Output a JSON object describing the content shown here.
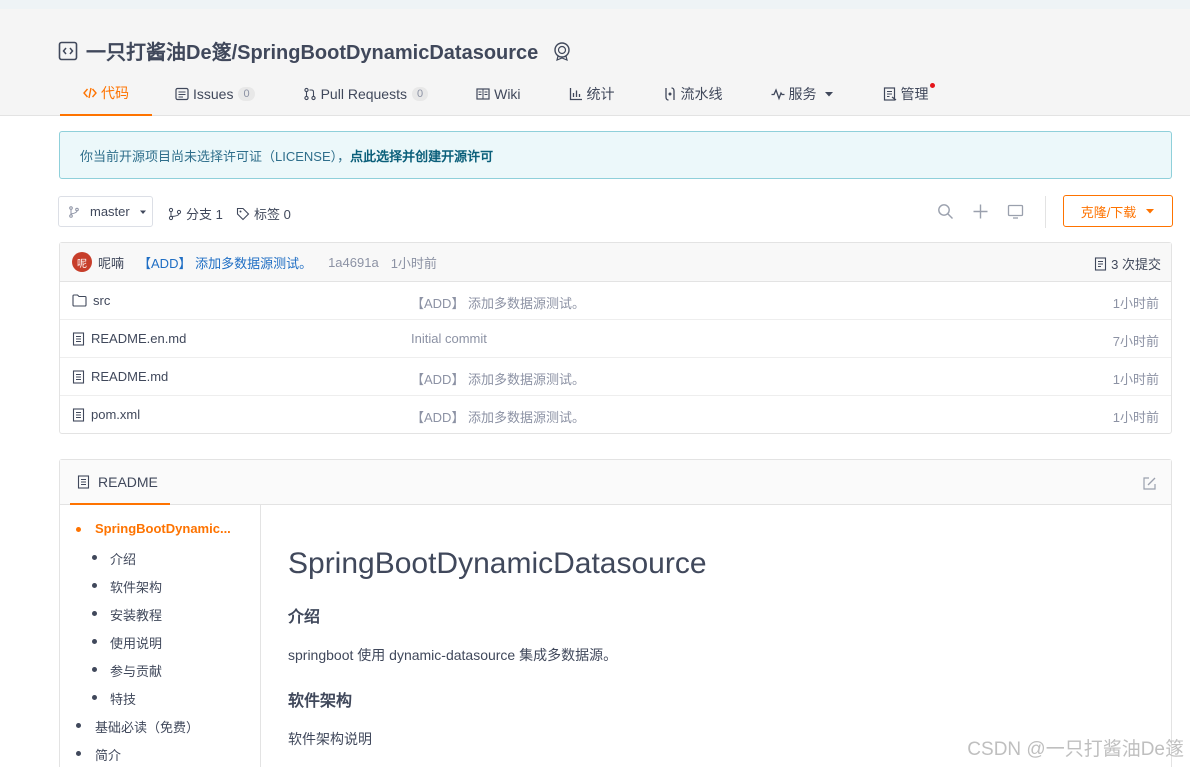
{
  "repo": {
    "title": "一只打酱油De篴/SpringBootDynamicDatasource"
  },
  "tabs": [
    {
      "label": "代码",
      "active": true
    },
    {
      "label": "Issues",
      "count": "0"
    },
    {
      "label": "Pull Requests",
      "count": "0"
    },
    {
      "label": "Wiki"
    },
    {
      "label": "统计"
    },
    {
      "label": "流水线"
    },
    {
      "label": "服务"
    },
    {
      "label": "管理"
    }
  ],
  "notice": {
    "text": "你当前开源项目尚未选择许可证（LICENSE），",
    "link": "点此选择并创建开源许可"
  },
  "branchbar": {
    "branch": "master",
    "branches": "分支 1",
    "tags": "标签 0",
    "clone": "克隆/下载"
  },
  "commit": {
    "avatar": "呢",
    "author": "呢喃",
    "message": "【ADD】 添加多数据源测试。",
    "sha": "1a4691a",
    "time": "1小时前",
    "count": "3 次提交"
  },
  "files": [
    {
      "name": "src",
      "type": "folder",
      "message": "【ADD】 添加多数据源测试。",
      "time": "1小时前"
    },
    {
      "name": "README.en.md",
      "type": "file",
      "message": "Initial commit",
      "time": "7小时前"
    },
    {
      "name": "README.md",
      "type": "file",
      "message": "【ADD】 添加多数据源测试。",
      "time": "1小时前"
    },
    {
      "name": "pom.xml",
      "type": "file",
      "message": "【ADD】 添加多数据源测试。",
      "time": "1小时前"
    }
  ],
  "readme": {
    "tab": "README",
    "toc": [
      {
        "label": "SpringBootDynamic...",
        "level": 1,
        "active": true
      },
      {
        "label": "介绍",
        "level": 2
      },
      {
        "label": "软件架构",
        "level": 2
      },
      {
        "label": "安装教程",
        "level": 2
      },
      {
        "label": "使用说明",
        "level": 2
      },
      {
        "label": "参与贡献",
        "level": 2
      },
      {
        "label": "特技",
        "level": 2
      },
      {
        "label": "基础必读（免费）",
        "level": 1
      },
      {
        "label": "简介",
        "level": 1
      }
    ],
    "h1": "SpringBootDynamicDatasource",
    "sections": [
      {
        "heading": "介绍",
        "text": "springboot 使用 dynamic-datasource 集成多数据源。"
      },
      {
        "heading": "软件架构",
        "text": "软件架构说明"
      }
    ]
  },
  "watermark": "CSDN @一只打酱油De篴",
  "colors": {
    "accent": "#fe7300",
    "text": "#40485b",
    "muted": "#8c92a4",
    "link": "#1f6ec4"
  }
}
